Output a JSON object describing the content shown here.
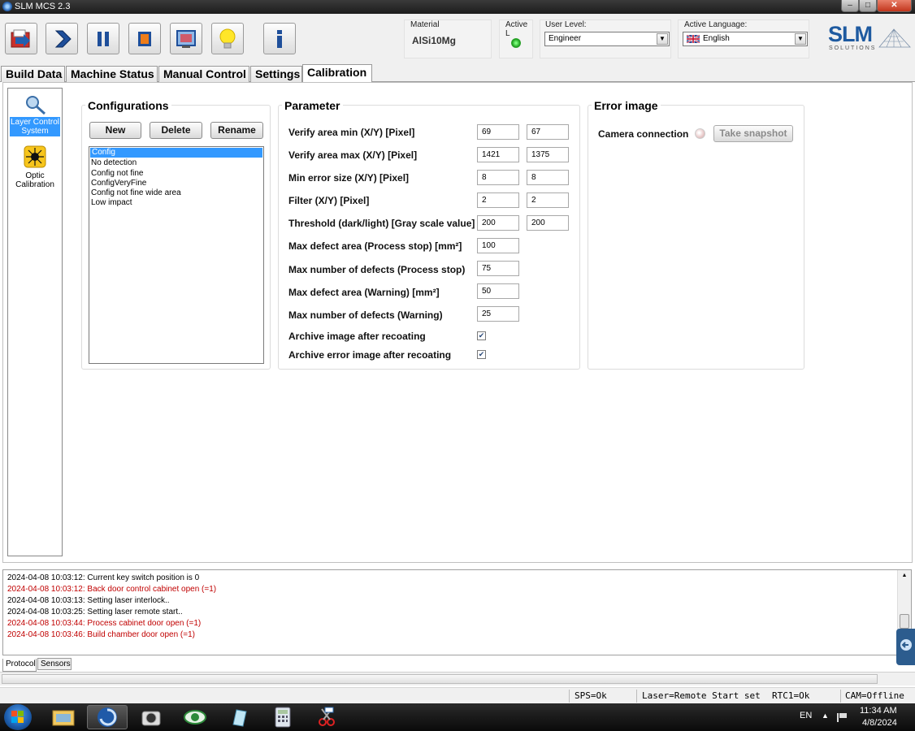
{
  "window": {
    "title": "SLM MCS 2.3",
    "min": "–",
    "max": "□",
    "close": "✕"
  },
  "toolbar": {
    "buttons": [
      {
        "name": "open-build-button",
        "icon": "folder-open-icon"
      },
      {
        "name": "start-button",
        "icon": "play-chevron-icon"
      },
      {
        "name": "pause-button",
        "icon": "pause-icon"
      },
      {
        "name": "stop-button",
        "icon": "stop-icon"
      },
      {
        "name": "screen-button",
        "icon": "monitor-icon"
      },
      {
        "name": "light-button",
        "icon": "lightbulb-icon"
      },
      {
        "name": "info-button",
        "icon": "info-icon"
      }
    ],
    "material_label": "Material",
    "material_value": "AlSi10Mg",
    "active_label": "Active L",
    "user_level_label": "User Level:",
    "user_level_value": "Engineer",
    "language_label": "Active Language:",
    "language_value": "English"
  },
  "logo": {
    "name": "SLM",
    "subtitle": "SOLUTIONS"
  },
  "tabs": [
    {
      "label": "Build Data",
      "active": false
    },
    {
      "label": "Machine Status",
      "active": false
    },
    {
      "label": "Manual Control",
      "active": false
    },
    {
      "label": "Settings",
      "active": false
    },
    {
      "label": "Calibration",
      "active": true
    }
  ],
  "sidebar": {
    "items": [
      {
        "label": "Layer Control System",
        "selected": true,
        "icon": "magnifier-wrench-icon"
      },
      {
        "label": "Optic Calibration",
        "selected": false,
        "icon": "laser-sun-icon"
      }
    ]
  },
  "configurations": {
    "title": "Configurations",
    "new_label": "New",
    "delete_label": "Delete",
    "rename_label": "Rename",
    "items": [
      "Config",
      "No detection",
      "Config not fine",
      "ConfigVeryFine",
      "Config not fine wide area",
      "Low impact"
    ],
    "selected_index": 0
  },
  "parameter": {
    "title": "Parameter",
    "rows": [
      {
        "label": "Verify area min (X/Y) [Pixel]",
        "v1": "69",
        "v2": "67"
      },
      {
        "label": "Verify area max (X/Y) [Pixel]",
        "v1": "1421",
        "v2": "1375"
      },
      {
        "label": "Min error size (X/Y) [Pixel]",
        "v1": "8",
        "v2": "8"
      },
      {
        "label": "Filter (X/Y) [Pixel]",
        "v1": "2",
        "v2": "2"
      },
      {
        "label": "Threshold (dark/light) [Gray scale value]",
        "v1": "200",
        "v2": "200"
      },
      {
        "label": "Max defect area (Process stop) [mm²]",
        "v1": "100"
      },
      {
        "label": "Max number of defects (Process stop)",
        "v1": "75"
      },
      {
        "label": "Max defect area (Warning) [mm²]",
        "v1": "50"
      },
      {
        "label": "Max number of defects (Warning)",
        "v1": "25"
      }
    ],
    "checks": [
      {
        "label": "Archive image after recoating",
        "checked": true
      },
      {
        "label": "Archive error image after recoating",
        "checked": true
      }
    ]
  },
  "error_image": {
    "title": "Error image",
    "camera_label": "Camera connection",
    "snapshot_label": "Take snapshot"
  },
  "log": {
    "lines": [
      {
        "text": "2024-04-08 10:03:12: Current key switch position is 0",
        "error": false
      },
      {
        "text": "2024-04-08 10:03:12: Back door control cabinet open (=1)",
        "error": true
      },
      {
        "text": "2024-04-08 10:03:13: Setting laser interlock..",
        "error": false
      },
      {
        "text": "2024-04-08 10:03:25: Setting laser remote start..",
        "error": false
      },
      {
        "text": "2024-04-08 10:03:44: Process cabinet door open (=1)",
        "error": true
      },
      {
        "text": "2024-04-08 10:03:46: Build chamber door open (=1)",
        "error": true
      }
    ],
    "tabs": [
      "Protocol",
      "Sensors"
    ]
  },
  "status": {
    "sps": "SPS=Ok",
    "laser": "Laser=Remote Start set",
    "rtc": "RTC1=Ok",
    "cam": "CAM=Offline"
  },
  "taskbar": {
    "lang": "EN",
    "time": "11:34 AM",
    "date": "4/8/2024",
    "apps": [
      "explorer-icon",
      "slm-mcs-icon",
      "camera-icon",
      "eye-icon",
      "notes-icon",
      "calculator-icon",
      "snipping-icon"
    ]
  },
  "colors": {
    "accent": "#3399ff",
    "error_text": "#c00000",
    "brand": "#1e5aa0"
  }
}
